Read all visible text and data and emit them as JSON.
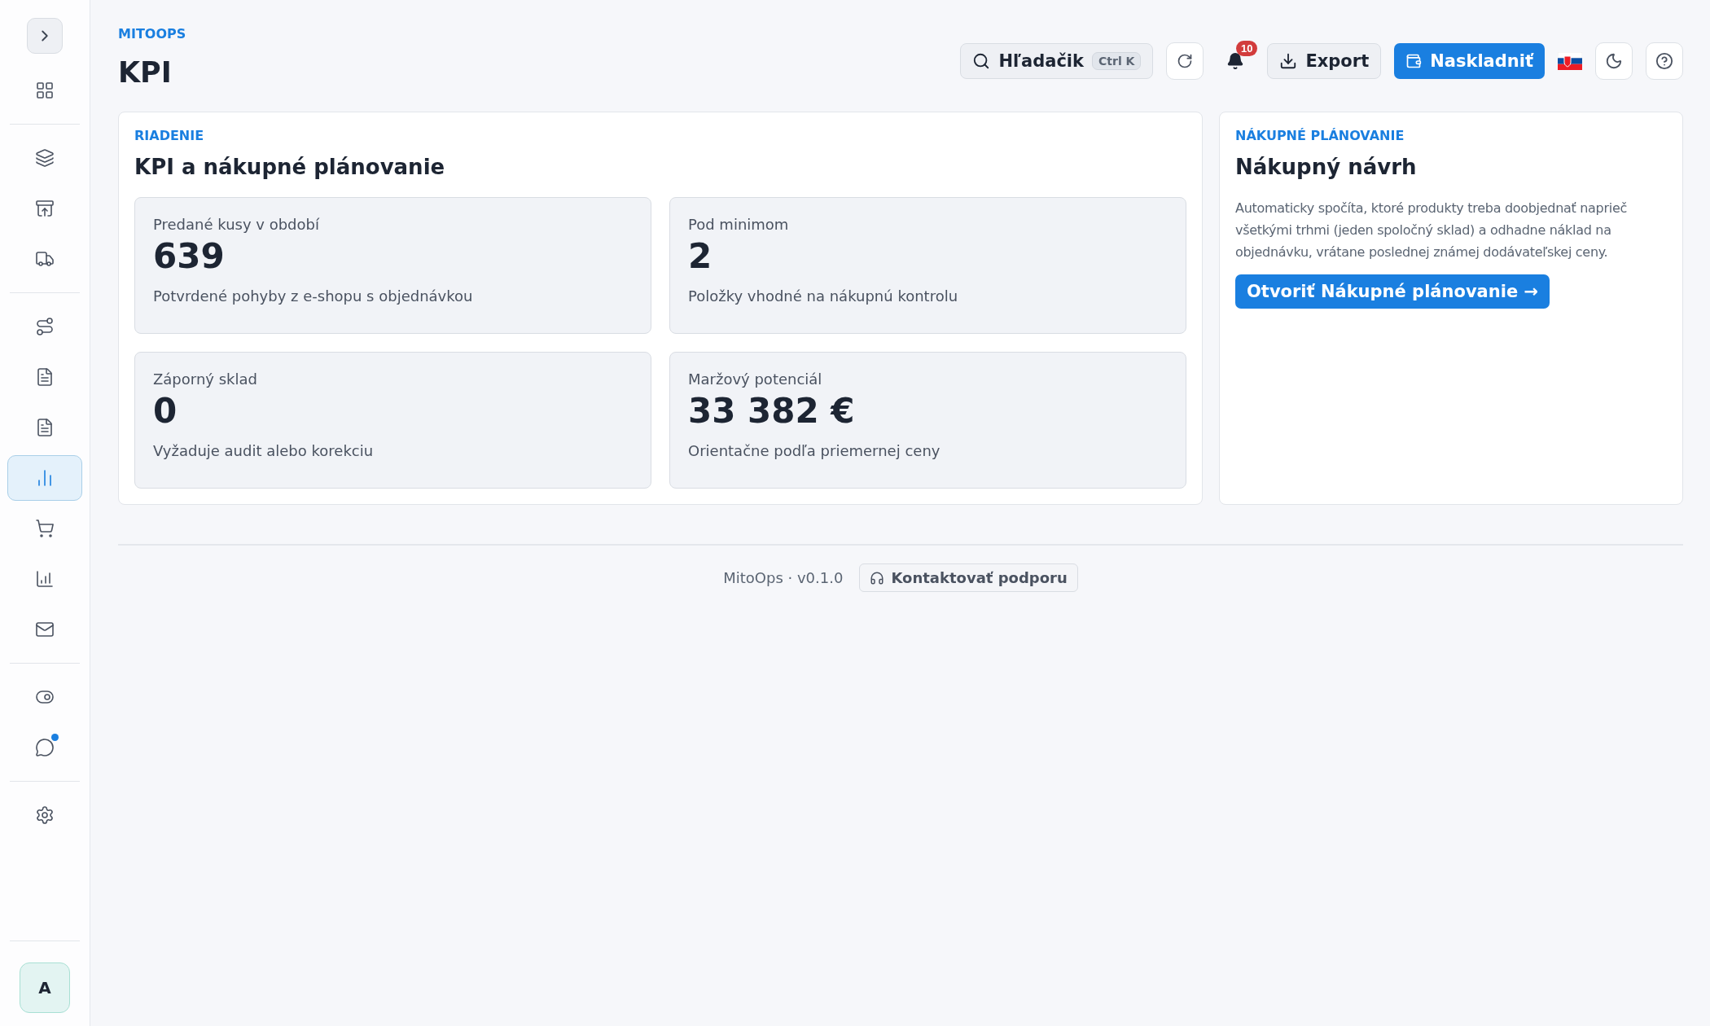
{
  "sidebar": {
    "toggle": {
      "expanded": false
    },
    "groups": [
      [
        {
          "selected": false,
          "unread": false
        }
      ],
      [
        {
          "selected": false,
          "unread": false
        },
        {
          "selected": false,
          "unread": false
        },
        {
          "selected": false,
          "unread": false
        }
      ],
      [
        {
          "selected": false,
          "unread": false
        },
        {
          "selected": false,
          "unread": false
        },
        {
          "selected": false,
          "unread": false
        },
        {
          "selected": true,
          "unread": false
        },
        {
          "selected": false,
          "unread": false
        },
        {
          "selected": false,
          "unread": false
        },
        {
          "selected": false,
          "unread": false
        }
      ],
      [
        {
          "selected": false,
          "unread": false
        },
        {
          "selected": false,
          "unread": true
        }
      ],
      [
        {
          "selected": false,
          "unread": false
        }
      ]
    ],
    "avatar": "A"
  },
  "header": {
    "eyebrow": "MITOOPS",
    "title": "KPI",
    "search": {
      "label": "Hľadačik",
      "shortcut": "Ctrl K"
    },
    "notifications": {
      "count": "10"
    },
    "export": "Export",
    "primary": "Naskladniť"
  },
  "kpi_panel": {
    "eyebrow": "RIADENIE",
    "title": "KPI a nákupné plánovanie",
    "tiles": [
      {
        "label": "Predané kusy v období",
        "value": "639",
        "note": "Potvrdené pohyby z e-shopu s objednávkou"
      },
      {
        "label": "Pod minimom",
        "value": "2",
        "note": "Položky vhodné na nákupnú kontrolu"
      },
      {
        "label": "Záporný sklad",
        "value": "0",
        "note": "Vyžaduje audit alebo korekciu"
      },
      {
        "label": "Maržový potenciál",
        "value": "33 382 €",
        "note": "Orientačne podľa priemernej ceny"
      }
    ]
  },
  "purchase_panel": {
    "eyebrow": "NÁKUPNÉ PLÁNOVANIE",
    "title": "Nákupný návrh",
    "text": "Automaticky spočíta, ktoré produkty treba doobjednať naprieč všetkými trhmi (jeden spoločný sklad) a odhadne náklad na objednávku, vrátane poslednej známej dodávateľskej ceny.",
    "button": "Otvoriť Nákupné plánovanie →"
  },
  "footer": {
    "version": "MitoOps · v0.1.0",
    "support": "Kontaktovať podporu"
  }
}
